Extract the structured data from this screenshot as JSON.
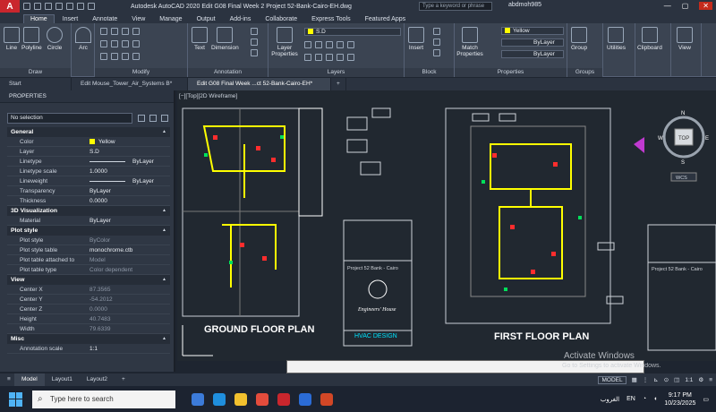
{
  "titlebar": {
    "logo": "A",
    "title": "Autodesk AutoCAD 2020    Edit G08 Final Week 2 Project 52-Bank-Cairo-EH.dwg",
    "search_placeholder": "Type a keyword or phrase",
    "user": "abdmoh985"
  },
  "ribbon_tabs": [
    "Home",
    "Insert",
    "Annotate",
    "View",
    "Manage",
    "Output",
    "Add-ins",
    "Collaborate",
    "Express Tools",
    "Featured Apps"
  ],
  "ribbon": {
    "draw": {
      "title": "Draw",
      "buttons": [
        "Line",
        "Polyline",
        "Circle",
        "Arc"
      ]
    },
    "modify": {
      "title": "Modify"
    },
    "annotation": {
      "title": "Annotation",
      "buttons": [
        "Text",
        "Dimension"
      ]
    },
    "layers": {
      "title": "Layers",
      "button": "Layer Properties",
      "current_layer": "S.D"
    },
    "block": {
      "title": "Block",
      "button": "Insert"
    },
    "properties": {
      "title": "Properties",
      "button": "Match Properties",
      "color": "Yellow",
      "lineweight": "ByLayer",
      "linetype": "ByLayer"
    },
    "groups": {
      "title": "Groups",
      "button": "Group"
    },
    "utilities": "Utilities",
    "clipboard": "Clipboard",
    "view": "View"
  },
  "doc_tabs": [
    "Start",
    "Edit Mouse_Tower_Air_Systems B*",
    "Edit G08 Final Week ...ct 52-Bank-Cairo-EH*"
  ],
  "properties_panel": {
    "title": "PROPERTIES",
    "selection": "No selection",
    "sections": [
      {
        "title": "General",
        "rows": [
          {
            "k": "Color",
            "v": "Yellow"
          },
          {
            "k": "Layer",
            "v": "S.D"
          },
          {
            "k": "Linetype",
            "v": "ByLayer"
          },
          {
            "k": "Linetype scale",
            "v": "1.0000"
          },
          {
            "k": "Lineweight",
            "v": "ByLayer"
          },
          {
            "k": "Transparency",
            "v": "ByLayer"
          },
          {
            "k": "Thickness",
            "v": "0.0000"
          }
        ]
      },
      {
        "title": "3D Visualization",
        "rows": [
          {
            "k": "Material",
            "v": "ByLayer"
          }
        ]
      },
      {
        "title": "Plot style",
        "rows": [
          {
            "k": "Plot style",
            "v": "ByColor"
          },
          {
            "k": "Plot style table",
            "v": "monochrome.ctb"
          },
          {
            "k": "Plot table attached to",
            "v": "Model"
          },
          {
            "k": "Plot table type",
            "v": "Color dependent"
          }
        ]
      },
      {
        "title": "View",
        "rows": [
          {
            "k": "Center X",
            "v": "87.3565"
          },
          {
            "k": "Center Y",
            "v": "-54.2012"
          },
          {
            "k": "Center Z",
            "v": "0.0000"
          },
          {
            "k": "Height",
            "v": "40.7483"
          },
          {
            "k": "Width",
            "v": "79.6339"
          }
        ]
      },
      {
        "title": "Misc",
        "rows": [
          {
            "k": "Annotation scale",
            "v": "1:1"
          }
        ]
      }
    ]
  },
  "viewport_label": "[−][Top][2D Wireframe]",
  "drawing": {
    "ground_title": "GROUND FLOOR PLAN",
    "first_title": "FIRST FLOOR PLAN",
    "titleblock_project": "Project 52 Bank - Cairo",
    "titleblock_design": "HVAC DESIGN",
    "titleblock_company": "Engineers' House",
    "viewcube": {
      "top": "TOP",
      "n": "N",
      "s": "S",
      "e": "E",
      "w": "W",
      "wcs": "WCS"
    }
  },
  "layout_tabs": [
    "Model",
    "Layout1",
    "Layout2"
  ],
  "status_bar": {
    "model": "MODEL",
    "scale": "1:1"
  },
  "watermark": {
    "title": "Activate Windows",
    "sub": "Go to Settings to activate Windows."
  },
  "taskbar": {
    "search_placeholder": "Type here to search",
    "lang": "EN",
    "weather": "الغروب",
    "time": "9:17 PM",
    "date": "10/23/2025"
  }
}
